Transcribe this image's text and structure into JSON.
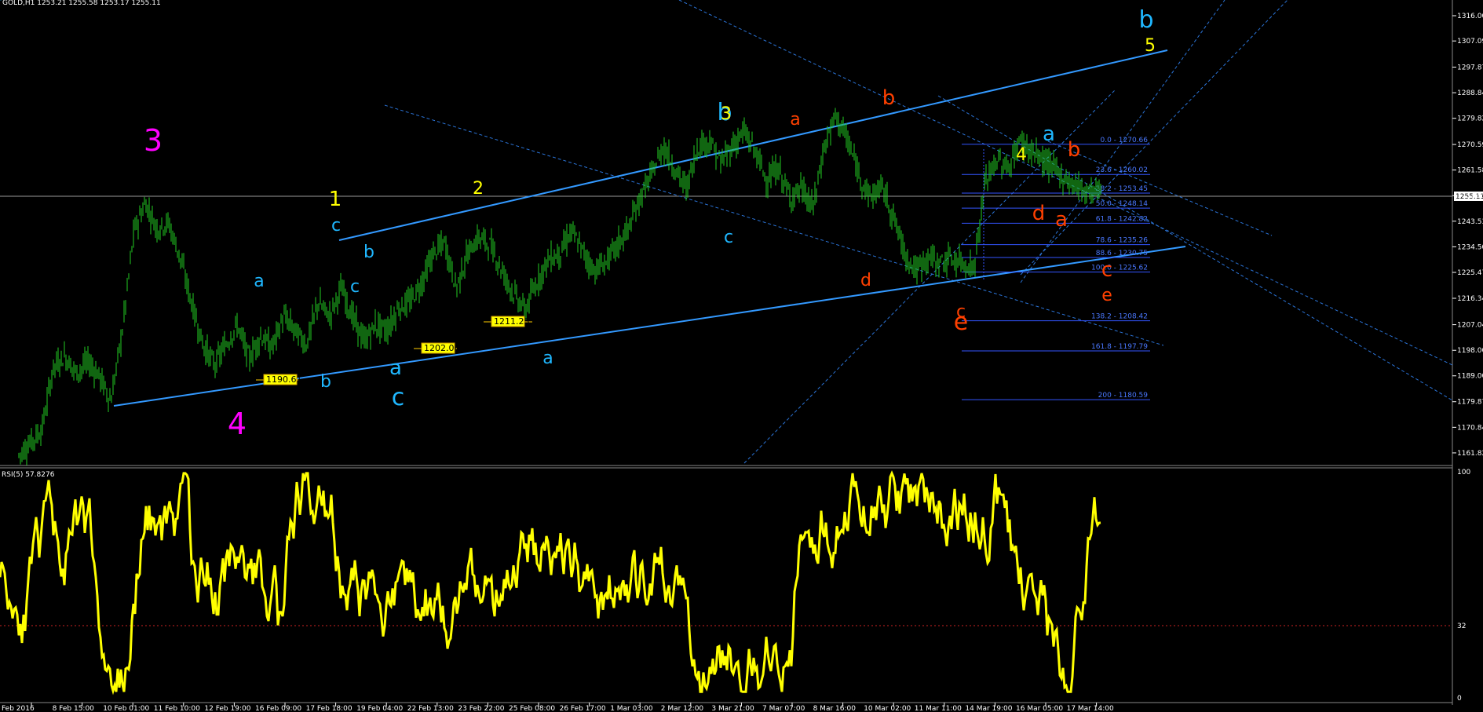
{
  "symbol_header": "GOLD,H1  1253.21 1255.58 1253.17 1255.11",
  "rsi_header": "RSI(5) 57.8276",
  "colors": {
    "background": "#000000",
    "candles": "#22cc22",
    "rsi_line": "#ffff00",
    "channel": "#3399ff",
    "fib": "#3355ff",
    "wave_magenta": "#ff00ff",
    "wave_yellow": "#ffff00",
    "wave_cyan": "#1fb7ff",
    "wave_orange": "#ff4000"
  },
  "chart_data": [
    {
      "type": "candlestick",
      "title": "GOLD,H1",
      "ylim": [
        1161.8,
        1316.0
      ],
      "price_axis_labels": [
        "1316.00",
        "1307.09",
        "1297.87",
        "1288.84",
        "1279.82",
        "1270.59",
        "1261.58",
        "1252.55",
        "1243.53",
        "1234.50",
        "1225.47",
        "1216.34",
        "1207.04",
        "1198.00",
        "1189.00",
        "1179.87",
        "1170.84",
        "1161.82"
      ],
      "current_price_label": "1255.11",
      "time_axis_labels": [
        "Feb 2016",
        "8 Feb 15:00",
        "10 Feb 01:00",
        "11 Feb 10:00",
        "12 Feb 19:00",
        "16 Feb 09:00",
        "17 Feb 18:00",
        "19 Feb 04:00",
        "22 Feb 13:00",
        "23 Feb 22:00",
        "25 Feb 08:00",
        "26 Feb 17:00",
        "1 Mar 03:00",
        "2 Mar 12:00",
        "3 Mar 21:00",
        "7 Mar 07:00",
        "8 Mar 16:00",
        "10 Mar 02:00",
        "11 Mar 11:00",
        "14 Mar 19:00",
        "16 Mar 05:00",
        "17 Mar 14:00"
      ],
      "price_path": [
        [
          0,
          1161
        ],
        [
          2,
          1170
        ],
        [
          3,
          1192
        ],
        [
          4,
          1196
        ],
        [
          5,
          1190
        ],
        [
          6,
          1194
        ],
        [
          7,
          1189
        ],
        [
          8,
          1180
        ],
        [
          9,
          1205
        ],
        [
          10,
          1240
        ],
        [
          11,
          1250
        ],
        [
          12,
          1241
        ],
        [
          13,
          1243
        ],
        [
          14,
          1231
        ],
        [
          15,
          1215
        ],
        [
          16,
          1200
        ],
        [
          17,
          1193
        ],
        [
          18,
          1200
        ],
        [
          19,
          1207
        ],
        [
          20,
          1195
        ],
        [
          21,
          1203
        ],
        [
          22,
          1199
        ],
        [
          23,
          1210
        ],
        [
          24,
          1205
        ],
        [
          25,
          1200
        ],
        [
          26,
          1215
        ],
        [
          27,
          1210
        ],
        [
          28,
          1220
        ],
        [
          29,
          1210
        ],
        [
          30,
          1201
        ],
        [
          31,
          1207
        ],
        [
          32,
          1205
        ],
        [
          33,
          1213
        ],
        [
          34,
          1215
        ],
        [
          35,
          1222
        ],
        [
          36,
          1232
        ],
        [
          37,
          1236
        ],
        [
          38,
          1220
        ],
        [
          39,
          1232
        ],
        [
          40,
          1238
        ],
        [
          41,
          1235
        ],
        [
          42,
          1226
        ],
        [
          43,
          1218
        ],
        [
          44,
          1212
        ],
        [
          45,
          1222
        ],
        [
          46,
          1230
        ],
        [
          47,
          1232
        ],
        [
          48,
          1240
        ],
        [
          49,
          1233
        ],
        [
          50,
          1226
        ],
        [
          51,
          1229
        ],
        [
          52,
          1235
        ],
        [
          53,
          1241
        ],
        [
          54,
          1252
        ],
        [
          55,
          1260
        ],
        [
          56,
          1270
        ],
        [
          57,
          1262
        ],
        [
          58,
          1255
        ],
        [
          59,
          1270
        ],
        [
          60,
          1272
        ],
        [
          61,
          1264
        ],
        [
          62,
          1270
        ],
        [
          63,
          1275
        ],
        [
          64,
          1268
        ],
        [
          65,
          1258
        ],
        [
          66,
          1262
        ],
        [
          67,
          1252
        ],
        [
          68,
          1255
        ],
        [
          69,
          1248
        ],
        [
          70,
          1270
        ],
        [
          71,
          1281
        ],
        [
          72,
          1272
        ],
        [
          73,
          1260
        ],
        [
          74,
          1252
        ],
        [
          75,
          1256
        ],
        [
          76,
          1245
        ],
        [
          77,
          1232
        ],
        [
          78,
          1226
        ],
        [
          79,
          1231
        ],
        [
          80,
          1229
        ],
        [
          81,
          1230
        ],
        [
          82,
          1229
        ],
        [
          83,
          1227
        ],
        [
          84,
          1258
        ],
        [
          85,
          1265
        ],
        [
          86,
          1262
        ],
        [
          87,
          1272
        ],
        [
          88,
          1268
        ],
        [
          89,
          1265
        ],
        [
          90,
          1262
        ],
        [
          91,
          1258
        ],
        [
          92,
          1256
        ],
        [
          93,
          1254
        ],
        [
          94,
          1255
        ]
      ],
      "price_labels": [
        "1190.61",
        "1202.06",
        "1211.23"
      ],
      "wave_labels": [
        {
          "text": "3",
          "color": "magenta"
        },
        {
          "text": "4",
          "color": "magenta"
        },
        {
          "text": "a",
          "color": "cyan"
        },
        {
          "text": "b",
          "color": "cyan"
        },
        {
          "text": "c",
          "color": "cyan"
        },
        {
          "text": "1",
          "color": "yellow"
        },
        {
          "text": "c",
          "color": "cyan"
        },
        {
          "text": "b",
          "color": "cyan"
        },
        {
          "text": "a",
          "color": "cyan"
        },
        {
          "text": "c",
          "color": "cyan"
        },
        {
          "text": "2",
          "color": "yellow"
        },
        {
          "text": "a",
          "color": "cyan"
        },
        {
          "text": "b",
          "color": "cyan"
        },
        {
          "text": "3",
          "color": "yellow"
        },
        {
          "text": "c",
          "color": "cyan"
        },
        {
          "text": "a",
          "color": "orange"
        },
        {
          "text": "b",
          "color": "orange"
        },
        {
          "text": "d",
          "color": "orange"
        },
        {
          "text": "c",
          "color": "orange"
        },
        {
          "text": "e",
          "color": "orange"
        },
        {
          "text": "4",
          "color": "yellow"
        },
        {
          "text": "a",
          "color": "cyan"
        },
        {
          "text": "b",
          "color": "orange"
        },
        {
          "text": "d",
          "color": "orange"
        },
        {
          "text": "a",
          "color": "orange"
        },
        {
          "text": "c",
          "color": "orange"
        },
        {
          "text": "e",
          "color": "orange"
        },
        {
          "text": "b",
          "color": "cyan"
        },
        {
          "text": "5",
          "color": "yellow"
        },
        {
          "text": "c",
          "color": "cyan"
        }
      ],
      "fibonacci_levels": [
        {
          "ratio": "0.0",
          "price": "1270.66"
        },
        {
          "ratio": "23.6",
          "price": "1260.02"
        },
        {
          "ratio": "38.2",
          "price": "1253.45"
        },
        {
          "ratio": "50.0",
          "price": "1248.14"
        },
        {
          "ratio": "61.8",
          "price": "1242.82"
        },
        {
          "ratio": "78.6",
          "price": "1235.26"
        },
        {
          "ratio": "88.6",
          "price": "1230.75"
        },
        {
          "ratio": "100.0",
          "price": "1225.62"
        },
        {
          "ratio": "138.2",
          "price": "1208.42"
        },
        {
          "ratio": "161.8",
          "price": "1197.79"
        },
        {
          "ratio": "200",
          "price": "1180.59"
        }
      ]
    },
    {
      "type": "line",
      "title": "RSI(5) 57.8276",
      "ylim": [
        0,
        100
      ],
      "axis_labels": [
        "100",
        "32",
        "0"
      ],
      "reference_level": 32
    }
  ]
}
